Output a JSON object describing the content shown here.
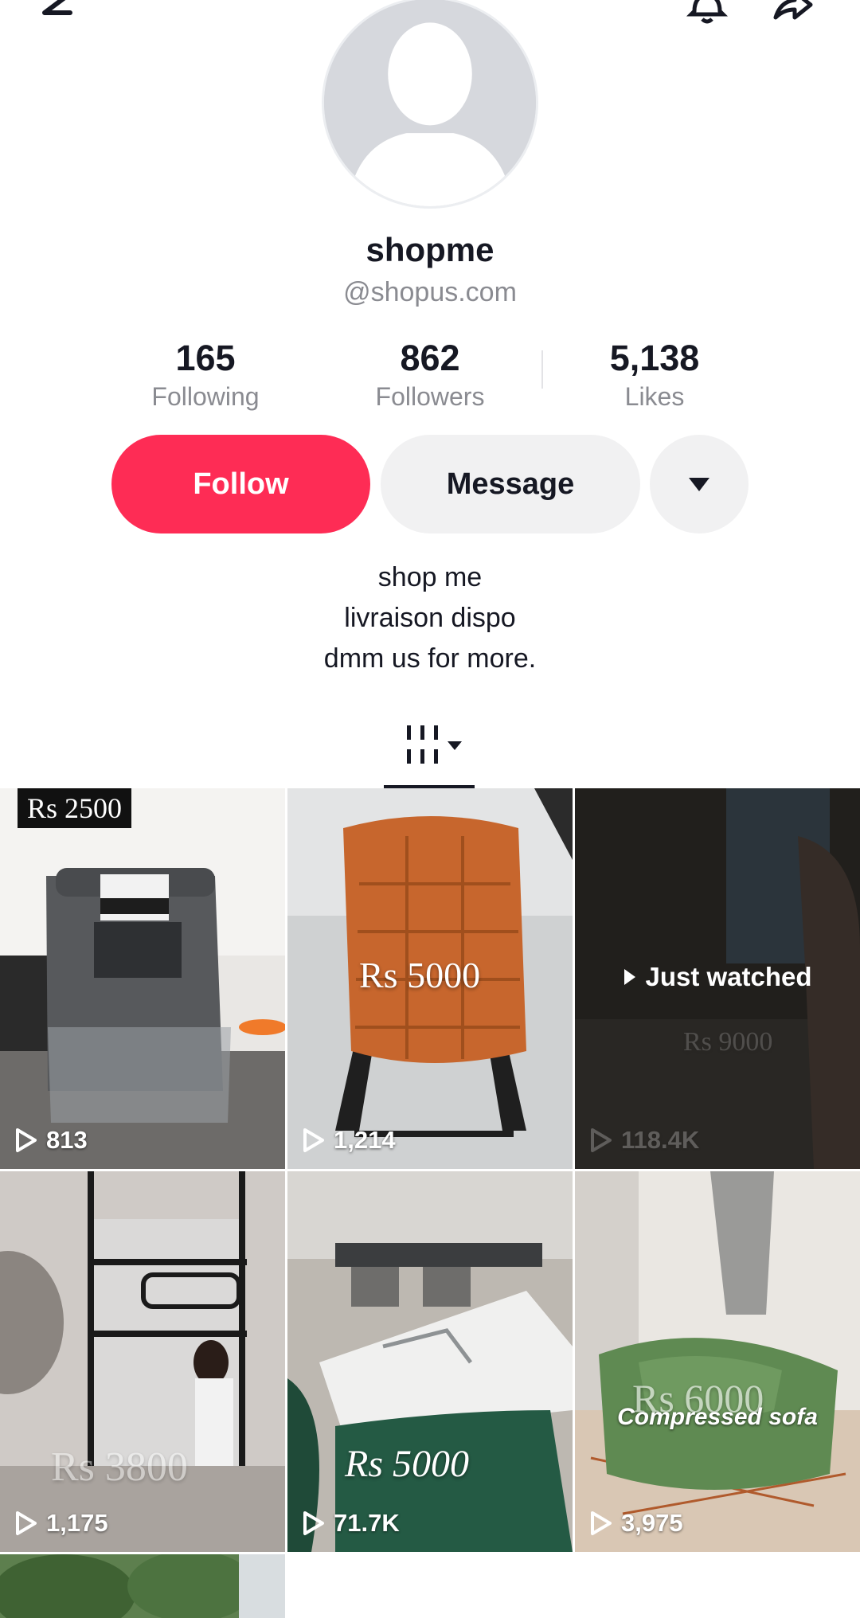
{
  "header": {
    "back_icon": "arrow-left-icon",
    "bell_icon": "bell-icon",
    "share_icon": "share-arrow-icon"
  },
  "profile": {
    "display_name": "shopme",
    "handle": "@shopus.com",
    "avatar_icon": "default-avatar-icon"
  },
  "stats": [
    {
      "value": "165",
      "label": "Following"
    },
    {
      "value": "862",
      "label": "Followers"
    },
    {
      "value": "5,138",
      "label": "Likes"
    }
  ],
  "actions": {
    "follow_label": "Follow",
    "message_label": "Message",
    "more_icon": "caret-down-icon",
    "follow_color": "#fe2c55"
  },
  "bio": {
    "lines": [
      "shop me",
      "livraison dispo",
      "dmm us for more."
    ]
  },
  "tabs": {
    "videos_icon": "grid-icon",
    "dropdown_icon": "caret-down-icon"
  },
  "videos": [
    {
      "views": "813",
      "price": "Rs 2500"
    },
    {
      "views": "1,214",
      "price": "Rs 5000"
    },
    {
      "views": "118.4K",
      "price": "Rs 9000",
      "overlay": "Just watched"
    },
    {
      "views": "1,175",
      "price": "Rs 3800"
    },
    {
      "views": "71.7K",
      "price": "Rs 5000"
    },
    {
      "views": "3,975",
      "price": "Rs 6000",
      "caption": "Compressed sofa"
    }
  ]
}
